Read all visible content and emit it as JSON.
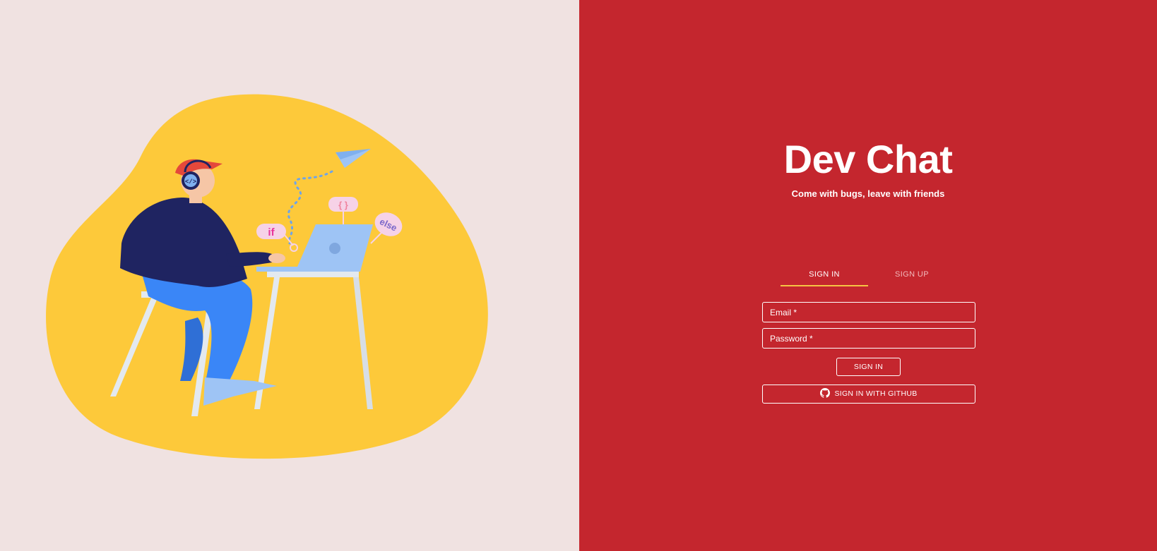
{
  "app": {
    "title": "Dev Chat",
    "tagline": "Come with bugs, leave with friends"
  },
  "illustration": {
    "labels": [
      "if",
      "{ }",
      "else"
    ]
  },
  "tabs": [
    {
      "label": "SIGN IN",
      "active": true
    },
    {
      "label": "SIGN UP",
      "active": false
    }
  ],
  "form": {
    "email_label": "Email *",
    "password_label": "Password *",
    "sign_in_label": "SIGN IN",
    "github_label": "SIGN IN WITH GITHUB"
  },
  "colors": {
    "left_background": "#f0e2e1",
    "right_background": "#c4262e",
    "accent": "#f6c343",
    "blob": "#fdc93a"
  },
  "icons": {
    "github": "github-icon",
    "paper_plane": "paper-plane-icon"
  }
}
